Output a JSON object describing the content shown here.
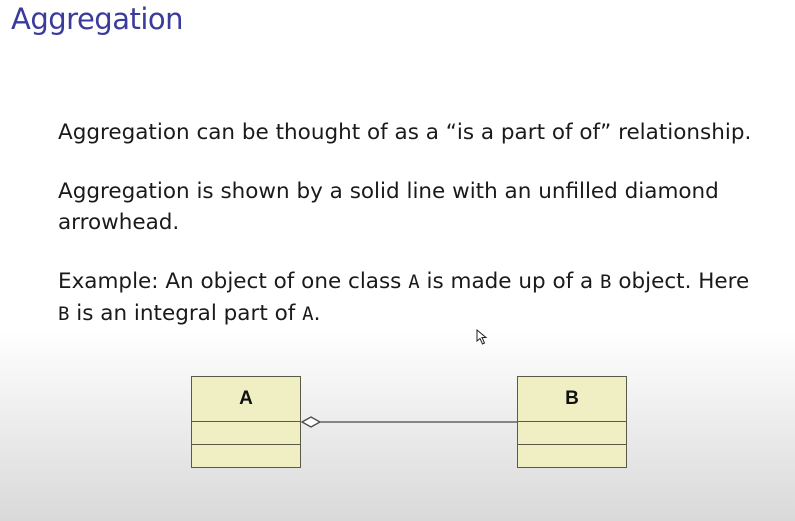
{
  "slide": {
    "title": "Aggregation",
    "paragraphs": {
      "p1": "Aggregation can be thought of as a “is a part of of” relationship.",
      "p2": "Aggregation is shown by a solid line with an unfilled diamond arrowhead.",
      "p3": {
        "t1": "Example: An object of one class ",
        "c1": "A",
        "t2": " is made up of a ",
        "c2": "B",
        "t3": " object. Here ",
        "c3": "B",
        "t4": " is an integral part of ",
        "c4": "A",
        "t5": "."
      }
    }
  },
  "diagram": {
    "class_a": {
      "name": "A"
    },
    "class_b": {
      "name": "B"
    },
    "relationship": "aggregation",
    "colors": {
      "class_fill": "#f0efc4",
      "class_border": "#5a5a4a",
      "title_color": "#3b3b9c"
    }
  },
  "icons": {
    "cursor": "mouse-pointer-icon"
  }
}
